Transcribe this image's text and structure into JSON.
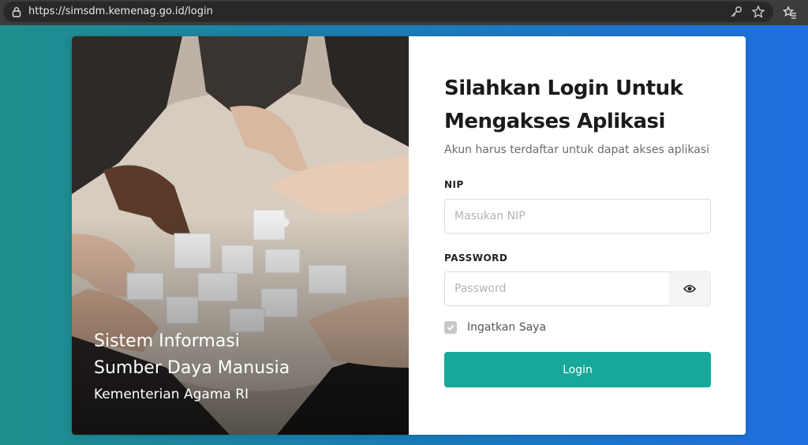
{
  "browser": {
    "url": "https://simsdm.kemenag.go.id/login"
  },
  "hero": {
    "title_line1": "Sistem Informasi",
    "title_line2": "Sumber Daya Manusia",
    "subtitle": "Kementerian Agama RI"
  },
  "login": {
    "heading_line1": "Silahkan Login Untuk",
    "heading_line2": "Mengakses Aplikasi",
    "subheading": "Akun harus terdaftar untuk dapat akses aplikasi",
    "nip_label": "NIP",
    "nip_placeholder": "Masukan NIP",
    "password_label": "PASSWORD",
    "password_placeholder": "Password",
    "remember_label": "Ingatkan Saya",
    "remember_checked": true,
    "submit_label": "Login"
  },
  "colors": {
    "accent": "#17a89a",
    "background_start": "#1f8f8c",
    "background_end": "#1f6fe0"
  },
  "icons": {
    "lock": "lock-icon",
    "key": "key-icon",
    "star": "star-icon",
    "favorites": "favorites-icon",
    "eye": "eye-icon",
    "check": "check-icon"
  }
}
